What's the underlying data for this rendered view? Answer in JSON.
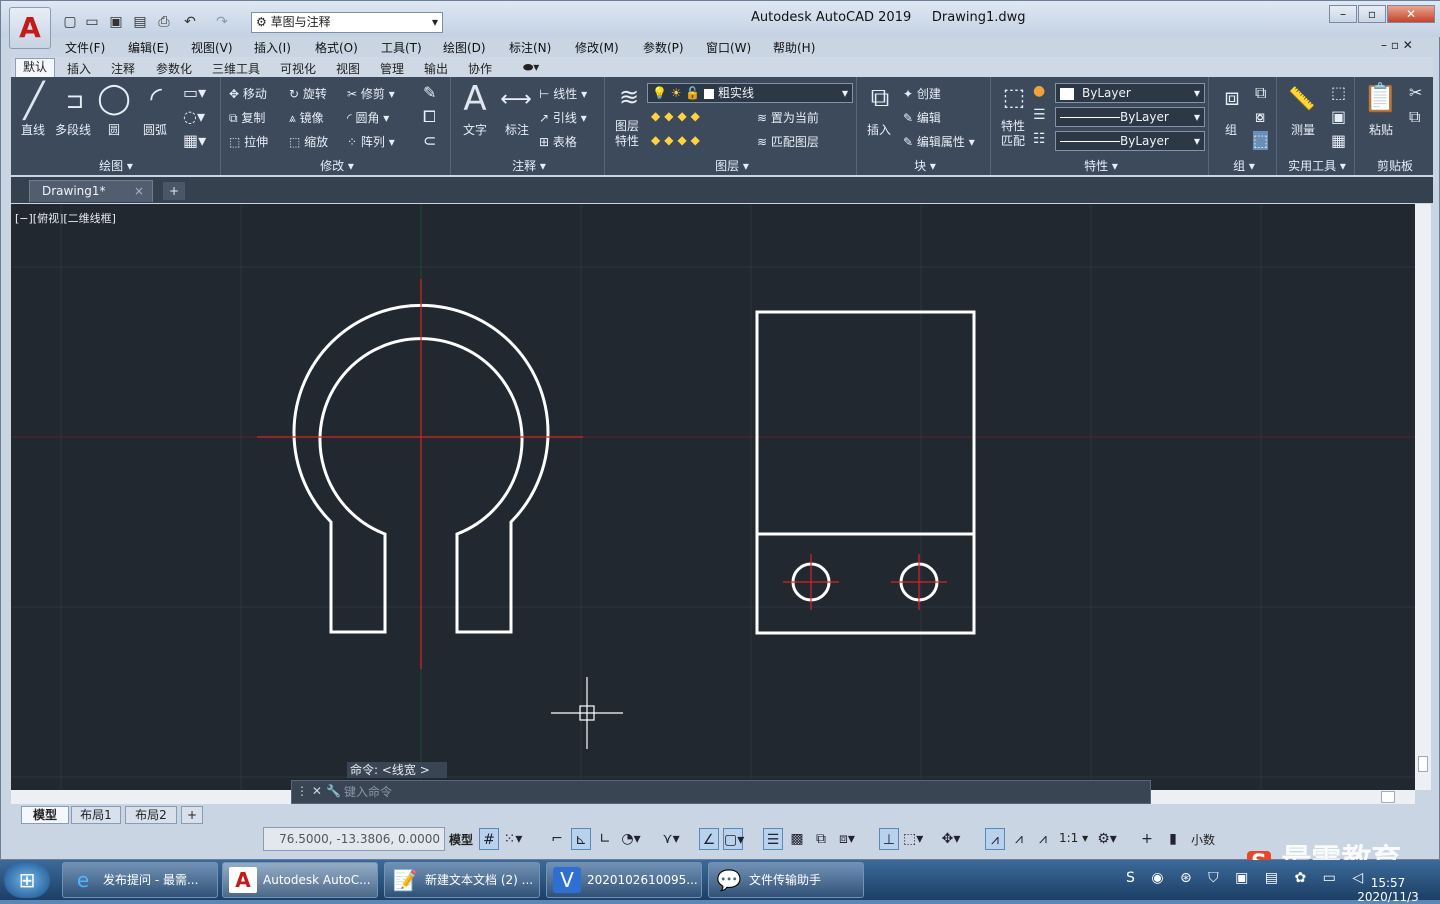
{
  "titlebar": {
    "workspace": "草图与注释",
    "app_title": "Autodesk AutoCAD 2019",
    "file_name": "Drawing1.dwg"
  },
  "menus": [
    "文件(F)",
    "编辑(E)",
    "视图(V)",
    "插入(I)",
    "格式(O)",
    "工具(T)",
    "绘图(D)",
    "标注(N)",
    "修改(M)",
    "参数(P)",
    "窗口(W)",
    "帮助(H)"
  ],
  "ribbon_tabs": [
    "默认",
    "插入",
    "注释",
    "参数化",
    "三维工具",
    "可视化",
    "视图",
    "管理",
    "输出",
    "协作"
  ],
  "panels": {
    "draw": {
      "title": "绘图 ▾",
      "line": "直线",
      "polyline": "多段线",
      "circle": "圆",
      "arc": "圆弧"
    },
    "modify": {
      "title": "修改 ▾",
      "move": "移动",
      "rotate": "旋转",
      "trim": "修剪",
      "copy": "复制",
      "mirror": "镜像",
      "fillet": "圆角",
      "stretch": "拉伸",
      "scale": "缩放",
      "array": "阵列"
    },
    "annotation": {
      "title": "注释 ▾",
      "text": "文字",
      "dimension": "标注",
      "linear": "线性",
      "leader": "引线",
      "table": "表格"
    },
    "layers": {
      "title": "图层 ▾",
      "layer_props": "图层特性",
      "current_layer": "粗实线",
      "make_current": "置为当前",
      "match_layer": "匹配图层"
    },
    "block": {
      "title": "块 ▾",
      "insert": "插入",
      "create": "创建",
      "edit": "编辑",
      "edit_attr": "编辑属性"
    },
    "properties": {
      "title": "特性 ▾",
      "match": "特性匹配",
      "color": "ByLayer",
      "linetype": "ByLayer",
      "lineweight": "ByLayer"
    },
    "groups": {
      "title": "组 ▾",
      "group": "组"
    },
    "utilities": {
      "title": "实用工具 ▾",
      "measure": "测量"
    },
    "clipboard": {
      "title": "剪贴板",
      "paste": "粘贴"
    }
  },
  "doc_tab": "Drawing1*",
  "viewport_label": "[−][俯视][二维线框]",
  "command": {
    "history": "命令: <线宽 >",
    "placeholder": "键入命令"
  },
  "layout_tabs": [
    "模型",
    "布局1",
    "布局2"
  ],
  "status": {
    "coords": "76.5000, -13.3806, 0.0000",
    "model": "模型",
    "scale": "1:1",
    "units": "小数"
  },
  "taskbar": [
    {
      "label": "发布提问 - 最需...",
      "icon": "ie-icon"
    },
    {
      "label": "Autodesk AutoC...",
      "icon": "autocad-icon"
    },
    {
      "label": "新建文本文档 (2) ...",
      "icon": "notepad-icon"
    },
    {
      "label": "2020102610095...",
      "icon": "video-icon"
    },
    {
      "label": "文件传输助手",
      "icon": "wechat-icon"
    }
  ],
  "clock": {
    "time": "15:57",
    "date": "2020/11/3"
  },
  "watermark": "最需教育"
}
